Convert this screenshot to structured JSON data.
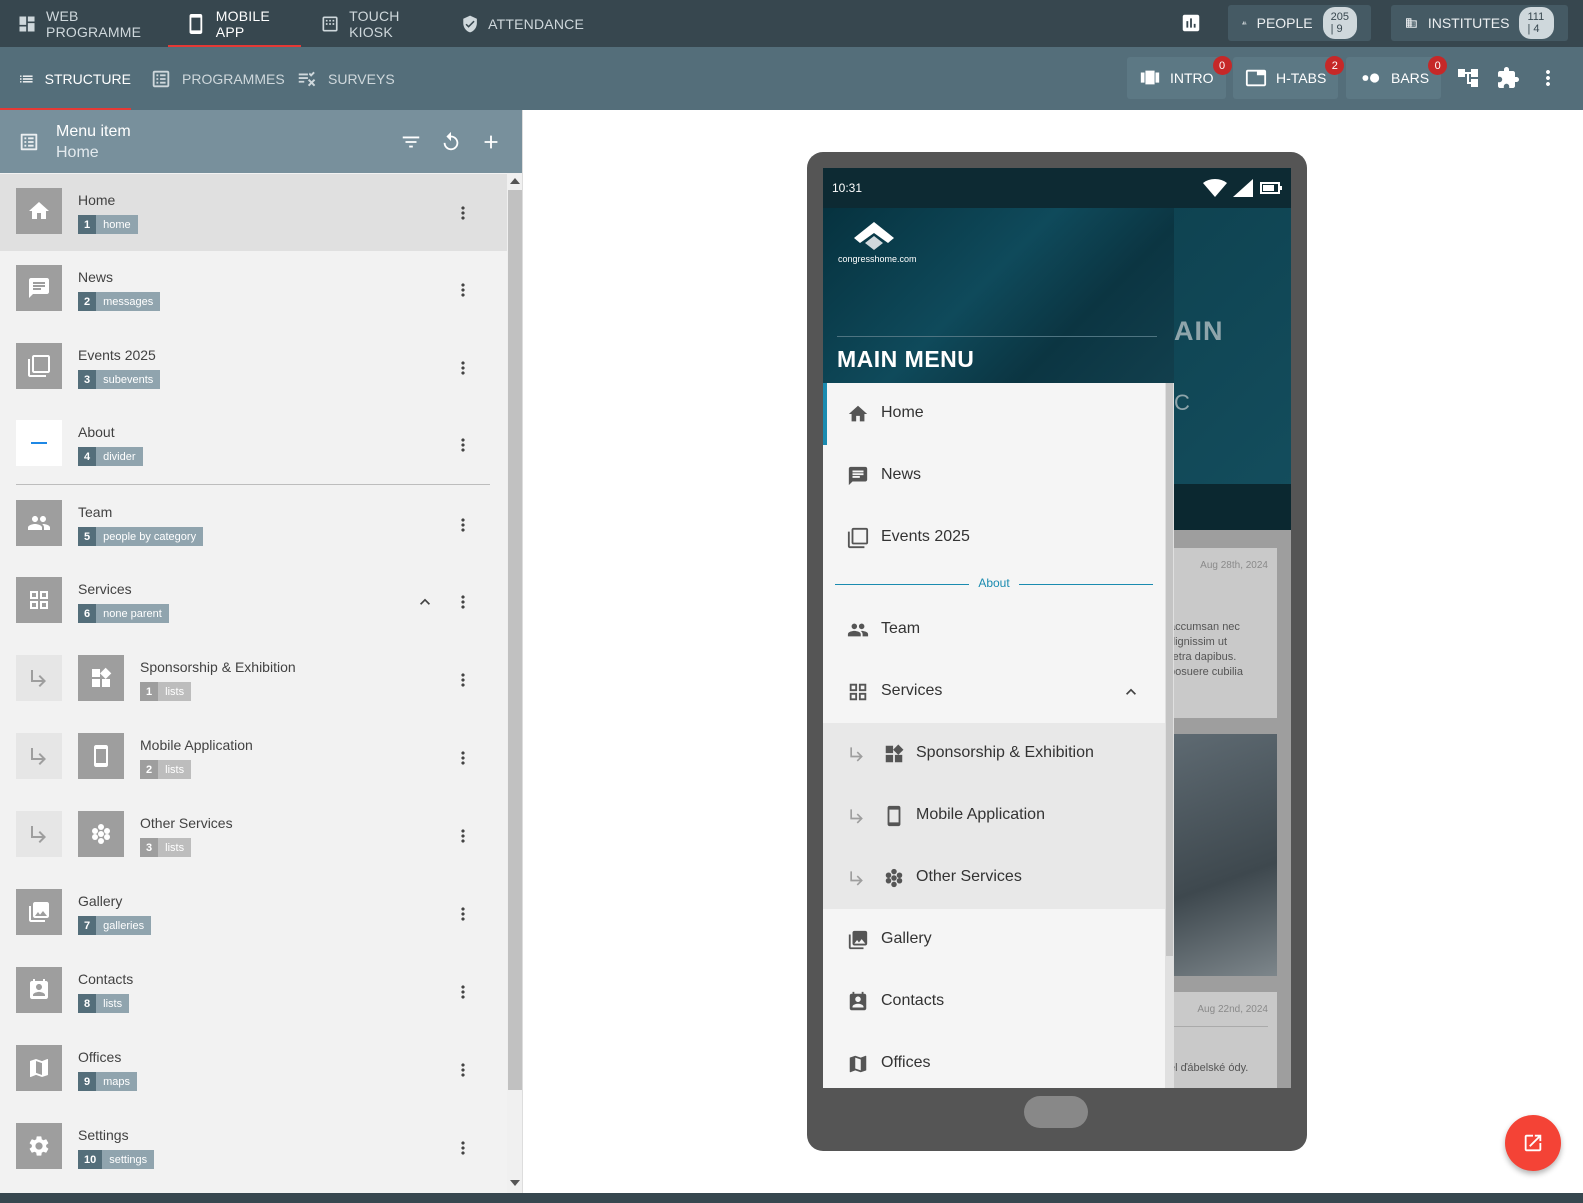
{
  "topbar": {
    "tabs": [
      {
        "label": "WEB PROGRAMME",
        "icon": "dashboard-icon"
      },
      {
        "label": "MOBILE APP",
        "icon": "smartphone-icon",
        "active": true
      },
      {
        "label": "TOUCH KIOSK",
        "icon": "kiosk-icon"
      },
      {
        "label": "ATTENDANCE",
        "icon": "badge-check-icon"
      }
    ],
    "people": {
      "label": "PEOPLE",
      "count": "205 | 9"
    },
    "institutes": {
      "label": "INSTITUTES",
      "count": "111 | 4"
    }
  },
  "secbar": {
    "tabs": [
      {
        "label": "STRUCTURE",
        "active": true
      },
      {
        "label": "PROGRAMMES"
      },
      {
        "label": "SURVEYS"
      }
    ],
    "intro": {
      "label": "INTRO",
      "badge": "0"
    },
    "htabs": {
      "label": "H-TABS",
      "badge": "2"
    },
    "bars": {
      "label": "BARS",
      "badge": "0"
    }
  },
  "panel": {
    "title": "Menu item",
    "subtitle": "Home",
    "items": [
      {
        "label": "Home",
        "num": "1",
        "type": "home"
      },
      {
        "label": "News",
        "num": "2",
        "type": "messages"
      },
      {
        "label": "Events 2025",
        "num": "3",
        "type": "subevents"
      },
      {
        "label": "About",
        "num": "4",
        "type": "divider"
      },
      {
        "label": "Team",
        "num": "5",
        "type": "people by category"
      },
      {
        "label": "Services",
        "num": "6",
        "type": "none parent"
      },
      {
        "label": "Sponsorship & Exhibition",
        "num": "1",
        "type": "lists"
      },
      {
        "label": "Mobile Application",
        "num": "2",
        "type": "lists"
      },
      {
        "label": "Other Services",
        "num": "3",
        "type": "lists"
      },
      {
        "label": "Gallery",
        "num": "7",
        "type": "galleries"
      },
      {
        "label": "Contacts",
        "num": "8",
        "type": "lists"
      },
      {
        "label": "Offices",
        "num": "9",
        "type": "maps"
      },
      {
        "label": "Settings",
        "num": "10",
        "type": "settings"
      }
    ]
  },
  "phone": {
    "time": "10:31",
    "logo_text": "congresshome.com",
    "drawer_title": "MAIN MENU",
    "bg_title_fragment": "AIN",
    "bg_letter": "C",
    "bg_date1": "Aug 28th, 2024",
    "bg_text": [
      "accumsan nec",
      "dignissim ut",
      "retra dapibus.",
      "posuere cubilia"
    ],
    "bg_date2": "Aug 22nd, 2024",
    "bg_text2": "ěl ďábelské ódy.",
    "menu": [
      {
        "label": "Home"
      },
      {
        "label": "News"
      },
      {
        "label": "Events 2025"
      },
      {
        "label": "About"
      },
      {
        "label": "Team"
      },
      {
        "label": "Services"
      },
      {
        "label": "Sponsorship & Exhibition"
      },
      {
        "label": "Mobile Application"
      },
      {
        "label": "Other Services"
      },
      {
        "label": "Gallery"
      },
      {
        "label": "Contacts"
      },
      {
        "label": "Offices"
      }
    ]
  },
  "colors": {
    "accent": "#e53935",
    "topbar": "#37474f",
    "secbar": "#546e7a",
    "drawer_accent": "#1a8bb0"
  }
}
